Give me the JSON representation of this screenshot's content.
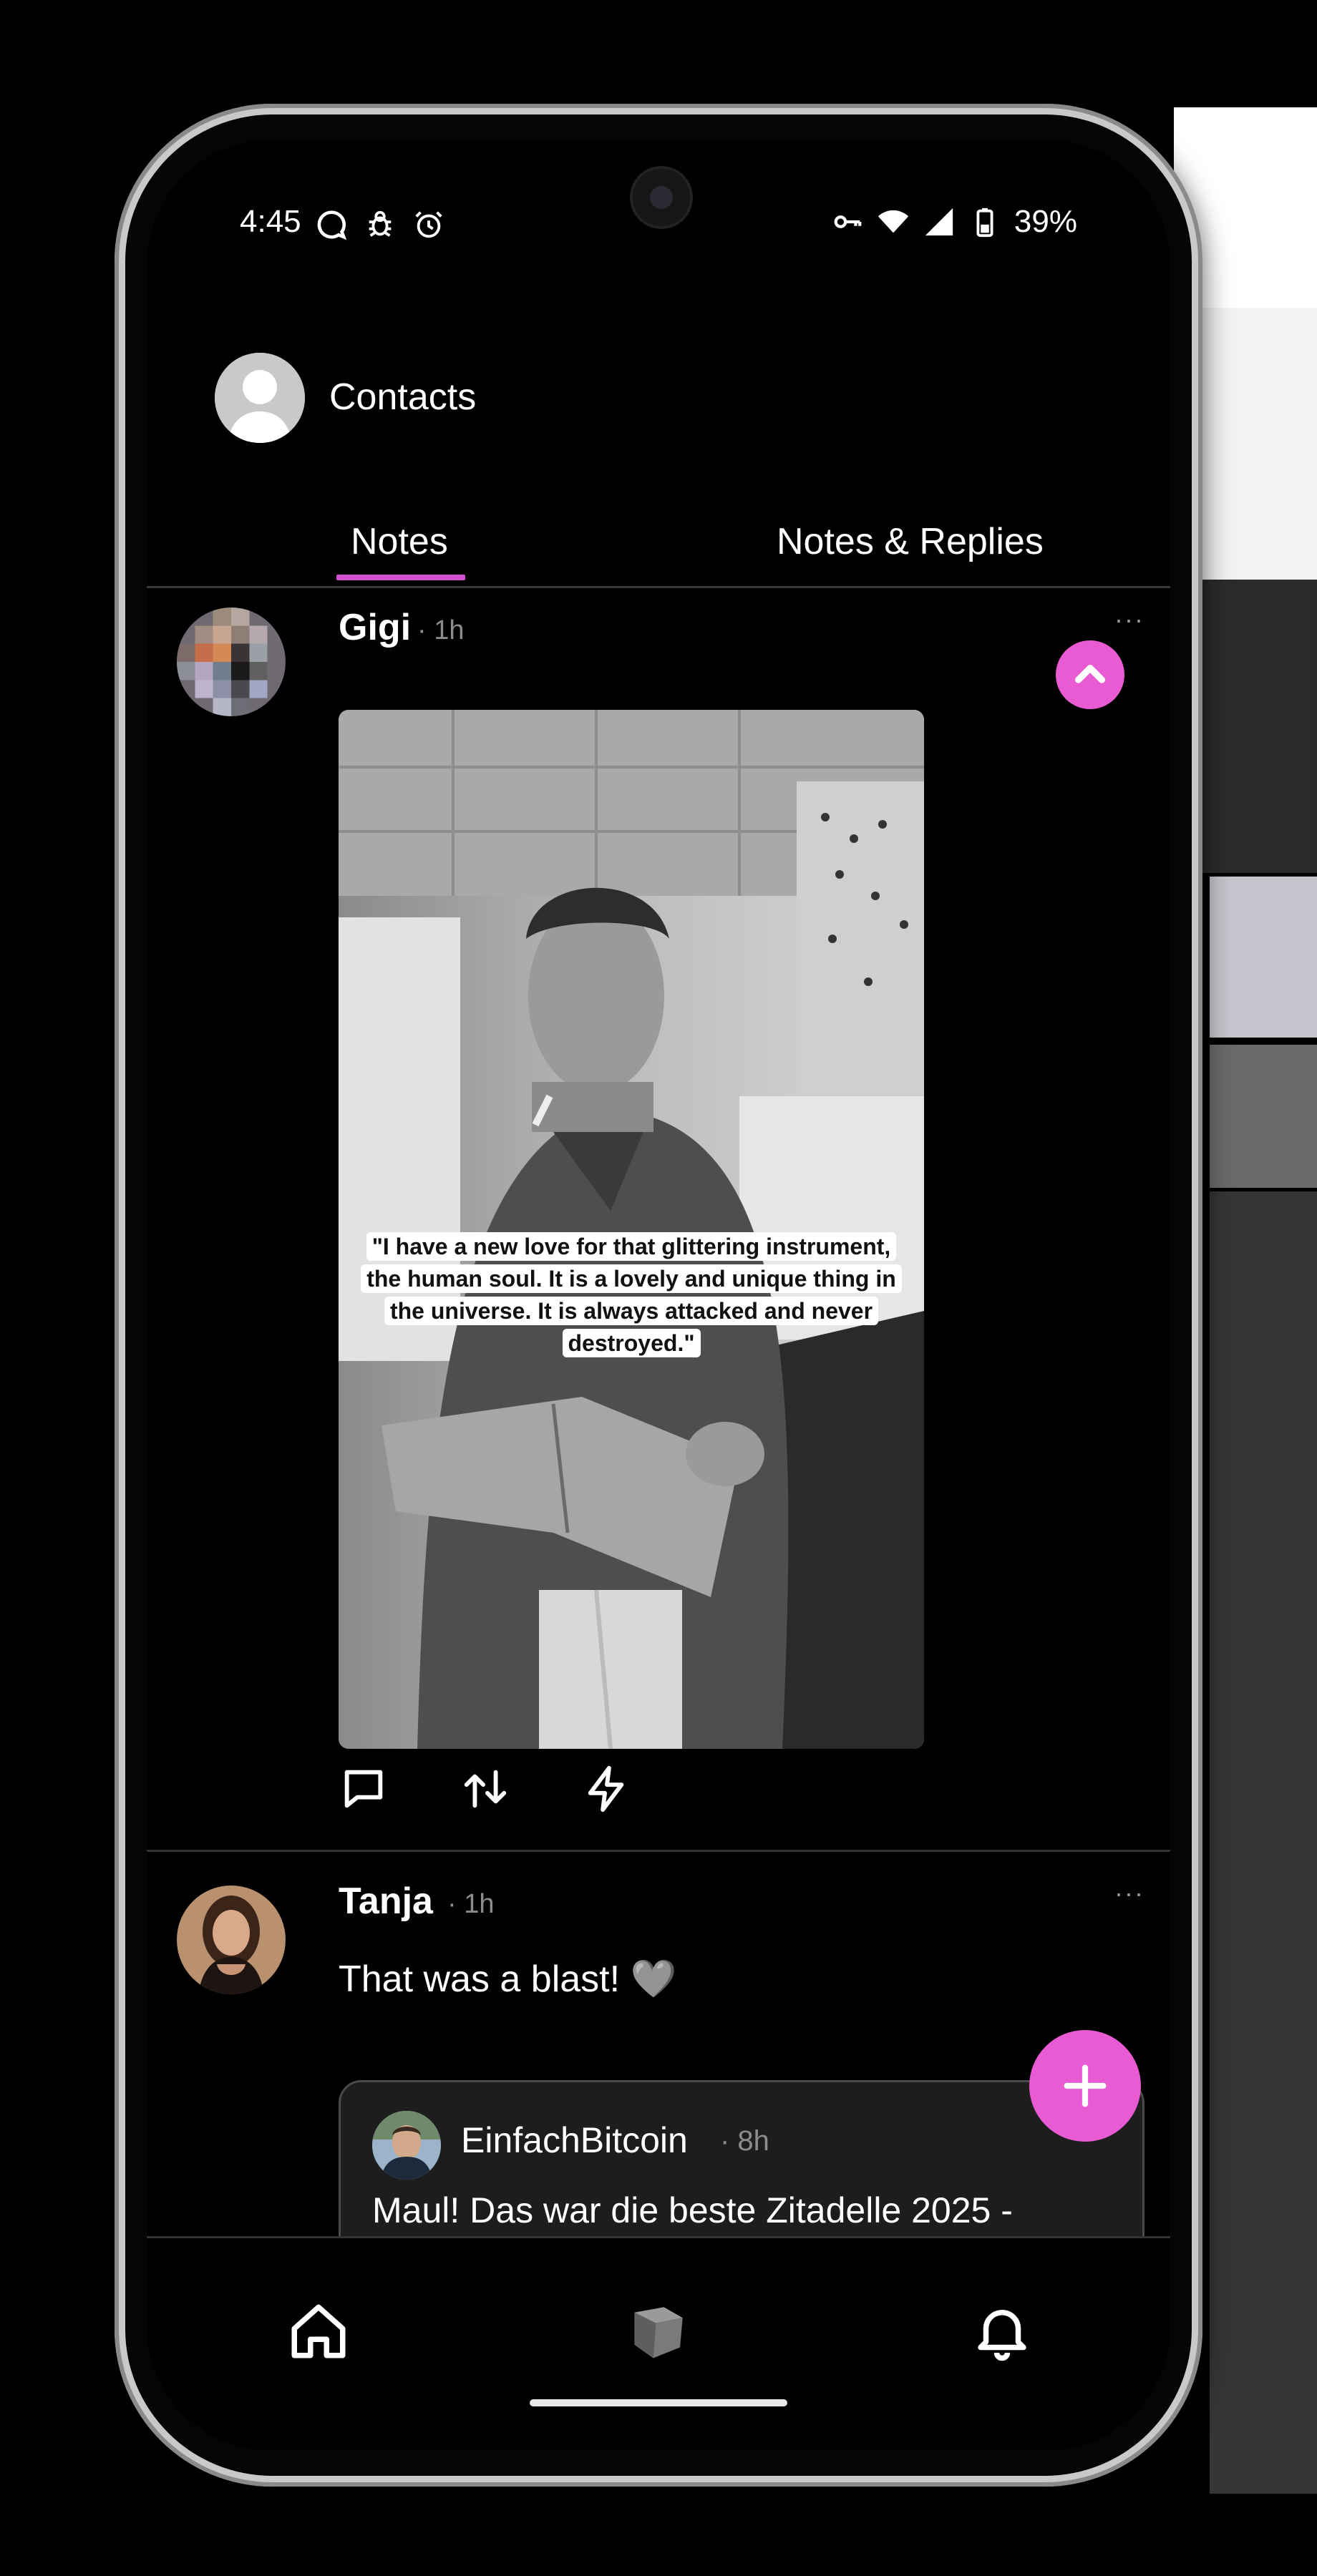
{
  "status_bar": {
    "time": "4:45",
    "battery": "39%",
    "left_icons": [
      "chat-bubble-icon",
      "bug-icon",
      "alarm-icon"
    ],
    "right_icons": [
      "vpn-key-icon",
      "wifi-icon",
      "signal-icon",
      "battery-icon"
    ]
  },
  "header": {
    "title": "Contacts"
  },
  "tabs": [
    {
      "label": "Notes",
      "active": true
    },
    {
      "label": "Notes & Replies",
      "active": false
    }
  ],
  "posts": [
    {
      "author": "Gigi",
      "time": "· 1h",
      "more": "···",
      "image_quote": "\"I have a new love for that glittering instrument, the human soul. It is a lovely and unique thing in the universe. It is always attacked and never destroyed.\"",
      "actions": [
        "reply-icon",
        "repost-icon",
        "zap-icon"
      ]
    },
    {
      "author": "Tanja",
      "time": "· 1h",
      "more": "···",
      "text": "That was a blast! 🩶",
      "quoted": {
        "author": "EinfachBitcoin",
        "time": "· 8h",
        "text": "Maul! Das war die beste Zitadelle 2025 -"
      }
    }
  ],
  "fab": {
    "icon": "plus-icon"
  },
  "scroll_top": {
    "icon": "chevron-up-icon"
  },
  "bottom_nav": [
    "home-icon",
    "cube-icon",
    "bell-icon"
  ],
  "colors": {
    "accent": "#e85bd2",
    "tab_underline": "#d44fd0",
    "background": "#000000",
    "muted_text": "#8c8c8c"
  }
}
